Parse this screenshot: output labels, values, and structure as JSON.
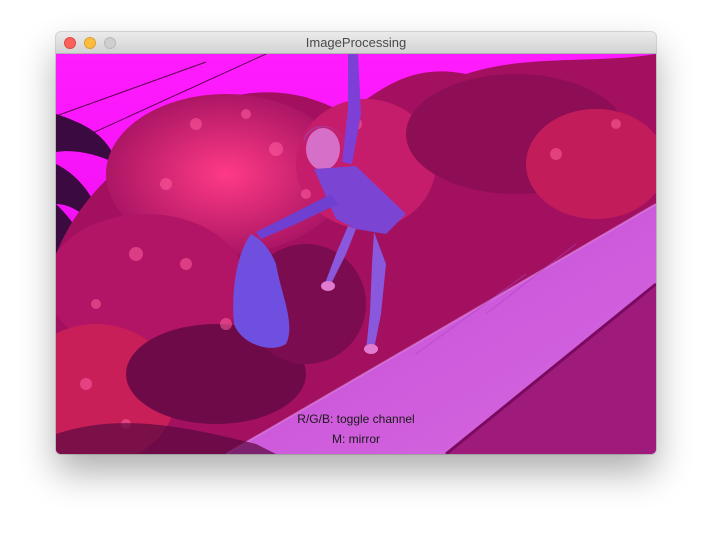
{
  "window": {
    "title": "ImageProcessing",
    "controls": {
      "close": "close-button",
      "minimize": "minimize-button",
      "zoom": "zoom-button"
    }
  },
  "canvas": {
    "hint_lines": [
      "R/G/B: toggle channel",
      "M: mirror"
    ],
    "tint_color": "#ff00ff"
  }
}
